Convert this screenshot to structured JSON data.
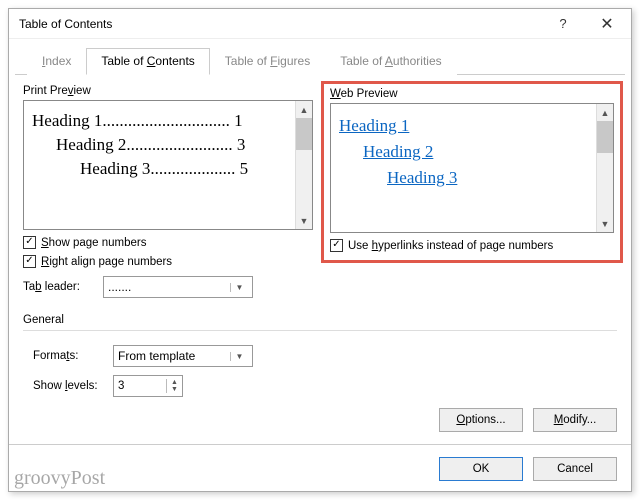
{
  "window": {
    "title": "Table of Contents"
  },
  "tabs": {
    "index": "Index",
    "toc": "Table of Contents",
    "figures": "Table of Figures",
    "authorities": "Table of Authorities"
  },
  "print_preview": {
    "label": "Print Preview",
    "lines": [
      {
        "text": "Heading 1",
        "dots": "..............................",
        "page": "1"
      },
      {
        "text": "Heading 2",
        "dots": ".........................",
        "page": "3"
      },
      {
        "text": "Heading 3",
        "dots": "....................",
        "page": "5"
      }
    ]
  },
  "web_preview": {
    "label": "Web Preview",
    "lines": [
      "Heading 1",
      "Heading 2",
      "Heading 3"
    ]
  },
  "checks": {
    "show_page_numbers": "Show page numbers",
    "right_align": "Right align page numbers",
    "use_hyperlinks": "Use hyperlinks instead of page numbers"
  },
  "tab_leader": {
    "label": "Tab leader:",
    "value": "......."
  },
  "general": {
    "label": "General",
    "formats_label": "Formats:",
    "formats_value": "From template",
    "show_levels_label": "Show levels:",
    "show_levels_value": "3"
  },
  "buttons": {
    "options": "Options...",
    "modify": "Modify...",
    "ok": "OK",
    "cancel": "Cancel"
  },
  "watermark": "groovyPost"
}
